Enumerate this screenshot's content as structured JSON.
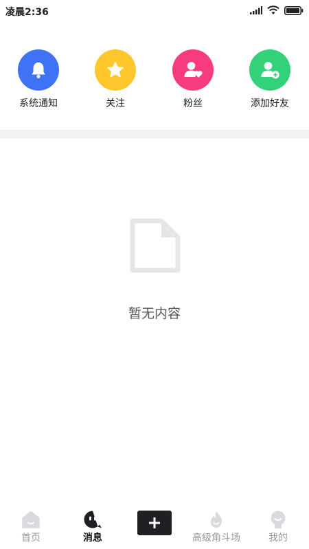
{
  "status_bar": {
    "time": "凌晨2:36"
  },
  "quick_actions": [
    {
      "label": "系统通知",
      "color": "#3F72F5",
      "icon": "bell-icon"
    },
    {
      "label": "关注",
      "color": "#FFC72C",
      "icon": "star-icon"
    },
    {
      "label": "粉丝",
      "color": "#F63C7E",
      "icon": "user-heart-icon"
    },
    {
      "label": "添加好友",
      "color": "#33D17A",
      "icon": "user-add-icon"
    }
  ],
  "empty_state": {
    "text": "暂无内容",
    "icon": "document-icon"
  },
  "tabbar": {
    "tabs": [
      {
        "label": "首页",
        "icon": "home-icon"
      },
      {
        "label": "消息",
        "icon": "message-icon",
        "active": true
      },
      {
        "label": "高级角斗场",
        "icon": "flame-icon"
      },
      {
        "label": "我的",
        "icon": "profile-icon"
      }
    ],
    "plus_icon": "plus-icon"
  }
}
